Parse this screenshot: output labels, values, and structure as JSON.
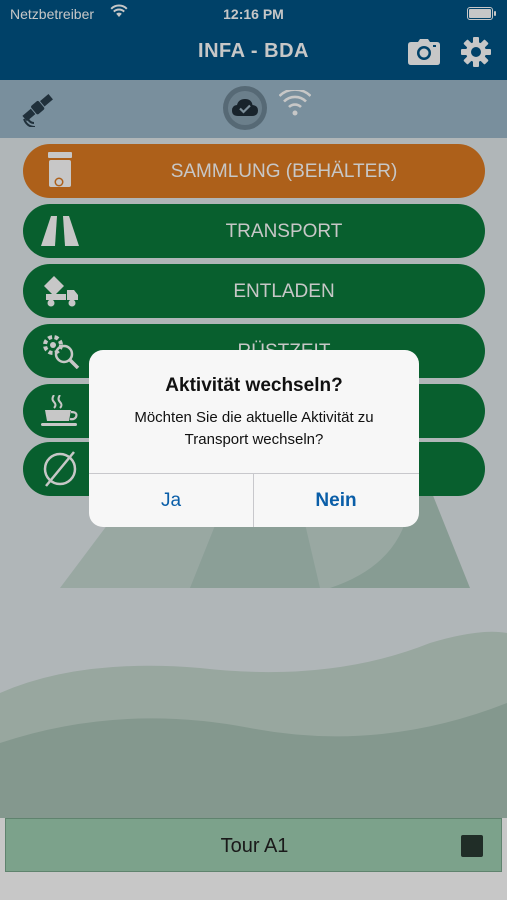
{
  "status_bar": {
    "carrier": "Netzbetreiber",
    "time": "12:16 PM"
  },
  "nav": {
    "title": "INFA - BDA",
    "camera_icon": "camera-icon",
    "settings_icon": "gear-icon"
  },
  "connectivity": {
    "satellite_icon": "satellite-icon",
    "cloud_icon": "cloud-check-icon",
    "wifi_icon": "wifi-icon"
  },
  "activities": [
    {
      "label": "SAMMLUNG (BEHÄLTER)",
      "icon": "bin-icon",
      "color": "#de7c22"
    },
    {
      "label": "TRANSPORT",
      "icon": "road-icon",
      "color": "#0b7a3b"
    },
    {
      "label": "ENTLADEN",
      "icon": "dump-truck-icon",
      "color": "#0b7a3b"
    },
    {
      "label": "RÜSTZEIT",
      "icon": "gear-search-icon",
      "color": "#0b7a3b"
    },
    {
      "label": "",
      "icon": "coffee-icon",
      "color": "#0b7a3b"
    },
    {
      "label": "",
      "icon": "empty-set-icon",
      "color": "#0b7a3b"
    }
  ],
  "footer": {
    "tour": "Tour A1",
    "stop_icon": "stop-icon"
  },
  "dialog": {
    "title": "Aktivität wechseln?",
    "message": "Möchten Sie die aktuelle Aktivität zu Transport wechseln?",
    "yes_label": "Ja",
    "no_label": "Nein"
  }
}
